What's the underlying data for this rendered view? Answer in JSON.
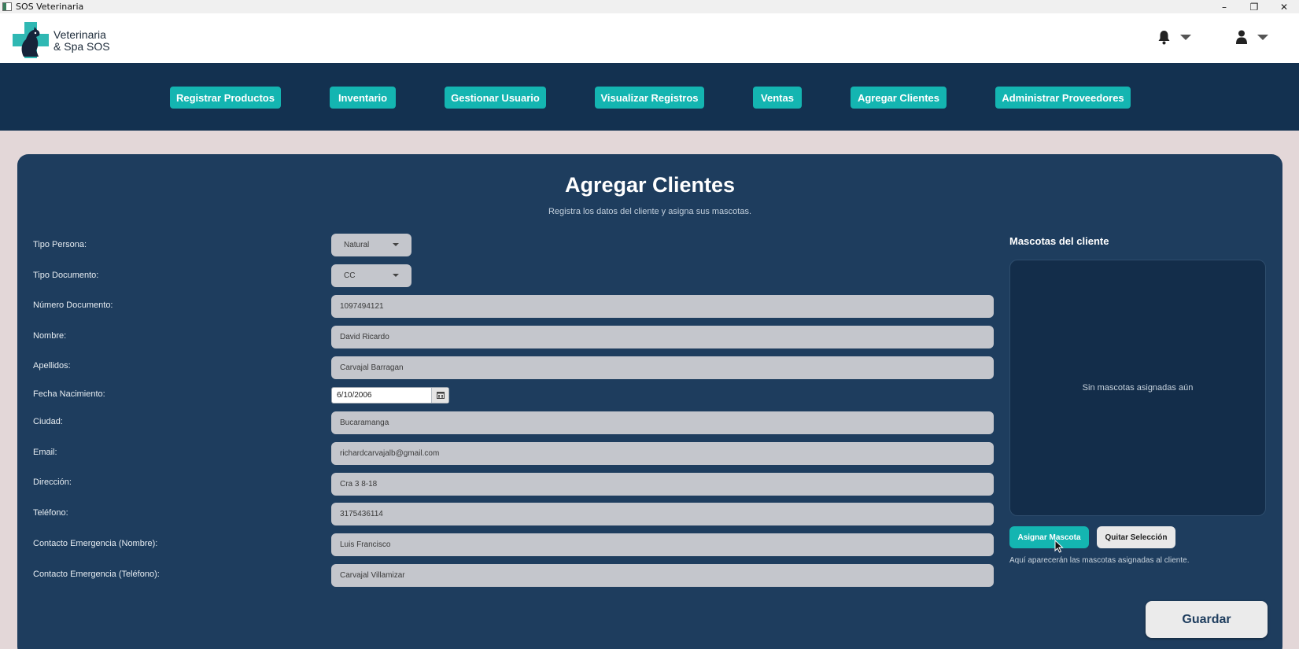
{
  "window": {
    "title": "SOS Veterinaria",
    "minimize": "–",
    "maximize": "❐",
    "close": "✕"
  },
  "header": {
    "brand_line1": "Veterinaria",
    "brand_line2": "& Spa SOS"
  },
  "nav": [
    {
      "label": "Registrar Productos"
    },
    {
      "label": "Inventario"
    },
    {
      "label": "Gestionar Usuario"
    },
    {
      "label": "Visualizar Registros"
    },
    {
      "label": "Ventas"
    },
    {
      "label": "Agregar Clientes"
    },
    {
      "label": "Administrar Proveedores"
    }
  ],
  "page": {
    "title": "Agregar Clientes",
    "subtitle": "Registra los datos del cliente y asigna sus mascotas."
  },
  "form": {
    "tipo_persona": {
      "label": "Tipo Persona:",
      "value": "Natural"
    },
    "tipo_documento": {
      "label": "Tipo Documento:",
      "value": "CC"
    },
    "numero_documento": {
      "label": "Número Documento:",
      "value": "1097494121"
    },
    "nombre": {
      "label": "Nombre:",
      "value": "David Ricardo"
    },
    "apellidos": {
      "label": "Apellidos:",
      "value": "Carvajal Barragan"
    },
    "fecha_nacimiento": {
      "label": "Fecha Nacimiento:",
      "value": "6/10/2006"
    },
    "ciudad": {
      "label": "Ciudad:",
      "value": "Bucaramanga"
    },
    "email": {
      "label": "Email:",
      "value": "richardcarvajalb@gmail.com"
    },
    "direccion": {
      "label": "Dirección:",
      "value": "Cra 3 8-18"
    },
    "telefono": {
      "label": "Teléfono:",
      "value": "3175436114"
    },
    "contacto_nombre": {
      "label": "Contacto Emergencia (Nombre):",
      "value": "Luis Francisco"
    },
    "contacto_telefono": {
      "label": "Contacto Emergencia (Teléfono):",
      "value": "Carvajal Villamizar"
    }
  },
  "pets": {
    "title": "Mascotas del cliente",
    "empty": "Sin mascotas asignadas aún",
    "assign_button": "Asignar Mascota",
    "remove_button": "Quitar Selección",
    "hint": "Aquí aparecerán las mascotas asignadas al cliente."
  },
  "save_button": "Guardar",
  "colors": {
    "accent": "#14b5b1",
    "nav_bg": "#133150",
    "card_bg": "#1e3d5e",
    "page_bg": "#e3d7d8"
  },
  "icons": [
    "app-icon",
    "logo",
    "bell-icon",
    "user-icon",
    "calendar-icon",
    "mouse-cursor"
  ]
}
